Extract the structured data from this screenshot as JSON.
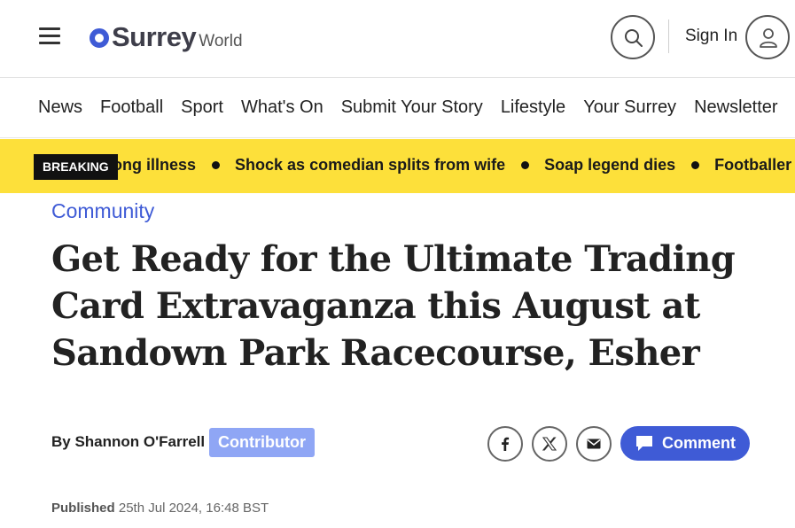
{
  "header": {
    "logo_main": "Surrey",
    "logo_sub": "World",
    "signin_label": "Sign In",
    "icons": [
      "menu-icon",
      "search-icon",
      "user-icon"
    ]
  },
  "nav": {
    "items": [
      "News",
      "Football",
      "Sport",
      "What's On",
      "Submit Your Story",
      "Lifestyle",
      "Your Surrey",
      "Newsletter"
    ]
  },
  "breaking": {
    "label": "BREAKING",
    "items": [
      "ong illness",
      "Shock as comedian splits from wife",
      "Soap legend dies",
      "Footballer jai"
    ]
  },
  "article": {
    "category": "Community",
    "headline_lines": [
      "Get Ready for the Ultimate Trading",
      "Card Extravaganza this August at",
      "Sandown Park Racecourse, Esher"
    ],
    "byline": "By Shannon O'Farrell",
    "author_badge": "Contributor",
    "comment_label": "Comment",
    "published_label": "Published",
    "published_date": "25th Jul 2024, 16:48 BST"
  },
  "share_icons": [
    "facebook-icon",
    "x-icon",
    "mail-icon"
  ],
  "colors": {
    "accent": "#3f5bd6",
    "breaking_bg": "#fde03a",
    "contributor_badge": "#8fa6f5"
  }
}
